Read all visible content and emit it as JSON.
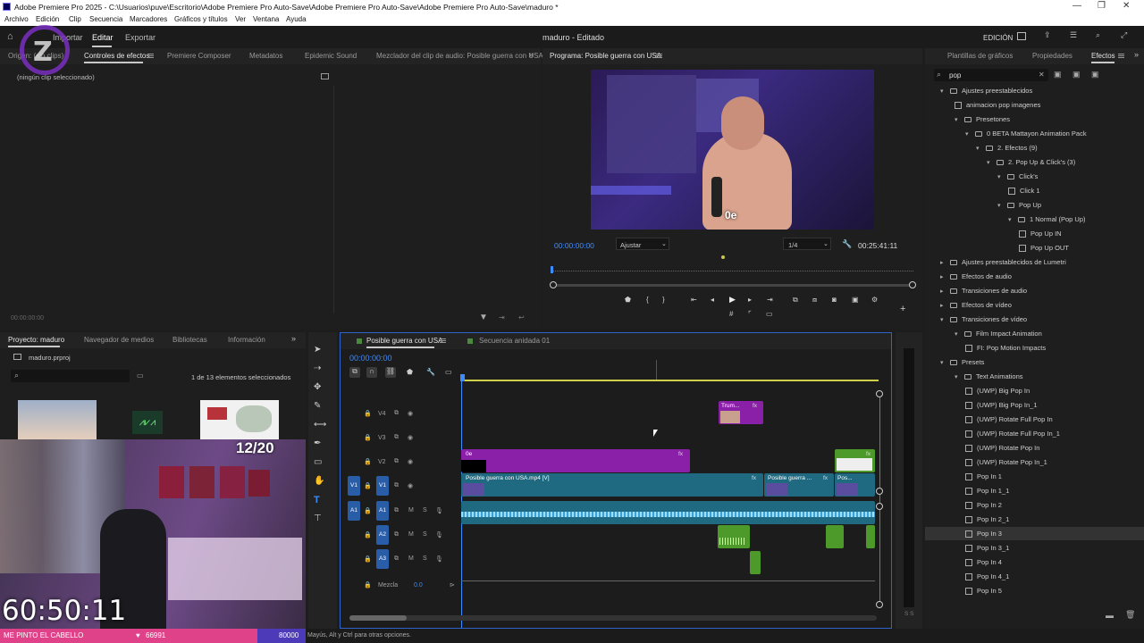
{
  "window": {
    "title": "Adobe Premiere Pro 2025 - C:\\Usuarios\\puve\\Escritorio\\Adobe Premiere Pro Auto-Save\\Adobe Premiere Pro Auto-Save\\Adobe Premiere Pro Auto-Save\\maduro *",
    "controls": [
      "—",
      "❐",
      "✕"
    ]
  },
  "menu": [
    "Archivo",
    "Edición",
    "Clip",
    "Secuencia",
    "Marcadores",
    "Gráficos y títulos",
    "Ver",
    "Ventana",
    "Ayuda"
  ],
  "topbar": {
    "tabs": [
      "Importar",
      "Editar",
      "Exportar"
    ],
    "project_title": "maduro - Editado",
    "workspace": "EDICIÓN"
  },
  "source_panel": {
    "tabs": [
      "Origen: (sin clips)",
      "Controles de efectos",
      "Premiere Composer",
      "Metadatos",
      "Epidemic Sound",
      "Mezclador del clip de audio: Posible guerra con USA"
    ],
    "no_clip": "(ningún clip seleccionado)",
    "timecode": "00:00:00:00"
  },
  "program": {
    "tab": "Programa: Posible guerra con USA",
    "timecode": "00:00:00:00",
    "fit": "Ajustar",
    "quality": "1/4",
    "duration": "00:25:41:11",
    "video_text": "0e"
  },
  "effects_panel": {
    "tabs": [
      "Plantillas de gráficos",
      "Propiedades",
      "Efectos"
    ],
    "search": "pop",
    "tree": [
      {
        "label": "Ajustes preestablecidos",
        "kind": "folder",
        "open": true,
        "level": 0
      },
      {
        "label": "animacion pop imagenes",
        "kind": "item",
        "level": 1
      },
      {
        "label": "Presetones",
        "kind": "folder",
        "open": true,
        "level": 1
      },
      {
        "label": "0 BETA Mattayon Animation Pack",
        "kind": "folder",
        "open": true,
        "level": 2
      },
      {
        "label": "2. Efectos (9)",
        "kind": "folder",
        "open": true,
        "level": 3
      },
      {
        "label": "2. Pop Up & Click's (3)",
        "kind": "folder",
        "open": true,
        "level": 4
      },
      {
        "label": "Click's",
        "kind": "folder",
        "open": true,
        "level": 5
      },
      {
        "label": "Click 1",
        "kind": "item",
        "level": 6
      },
      {
        "label": "Pop Up",
        "kind": "folder",
        "open": true,
        "level": 5
      },
      {
        "label": "1 Normal (Pop Up)",
        "kind": "folder",
        "open": true,
        "level": 6
      },
      {
        "label": "Pop Up IN",
        "kind": "item",
        "level": 7
      },
      {
        "label": "Pop Up OUT",
        "kind": "item",
        "level": 7
      },
      {
        "label": "Ajustes preestablecidos de Lumetri",
        "kind": "folder",
        "open": false,
        "level": 0
      },
      {
        "label": "Efectos de audio",
        "kind": "folder",
        "open": false,
        "level": 0
      },
      {
        "label": "Transiciones de audio",
        "kind": "folder",
        "open": false,
        "level": 0
      },
      {
        "label": "Efectos de vídeo",
        "kind": "folder",
        "open": false,
        "level": 0
      },
      {
        "label": "Transiciones de vídeo",
        "kind": "folder",
        "open": true,
        "level": 0
      },
      {
        "label": "Film Impact Animation",
        "kind": "folder",
        "open": true,
        "level": 1
      },
      {
        "label": "FI: Pop Motion Impacts",
        "kind": "item",
        "level": 2
      },
      {
        "label": "Presets",
        "kind": "folder",
        "open": true,
        "level": 0
      },
      {
        "label": "Text Animations",
        "kind": "folder",
        "open": true,
        "level": 1
      },
      {
        "label": "(UWP) Big Pop In",
        "kind": "item",
        "level": 2
      },
      {
        "label": "(UWP) Big Pop In_1",
        "kind": "item",
        "level": 2
      },
      {
        "label": "(UWP) Rotate Full Pop In",
        "kind": "item",
        "level": 2
      },
      {
        "label": "(UWP) Rotate Full Pop In_1",
        "kind": "item",
        "level": 2
      },
      {
        "label": "(UWP) Rotate Pop In",
        "kind": "item",
        "level": 2
      },
      {
        "label": "(UWP) Rotate Pop In_1",
        "kind": "item",
        "level": 2
      },
      {
        "label": "Pop In 1",
        "kind": "item",
        "level": 2
      },
      {
        "label": "Pop In 1_1",
        "kind": "item",
        "level": 2
      },
      {
        "label": "Pop In 2",
        "kind": "item",
        "level": 2
      },
      {
        "label": "Pop In 2_1",
        "kind": "item",
        "level": 2
      },
      {
        "label": "Pop In 3",
        "kind": "item",
        "level": 2,
        "selected": true
      },
      {
        "label": "Pop In 3_1",
        "kind": "item",
        "level": 2
      },
      {
        "label": "Pop In 4",
        "kind": "item",
        "level": 2
      },
      {
        "label": "Pop In 4_1",
        "kind": "item",
        "level": 2
      },
      {
        "label": "Pop In 5",
        "kind": "item",
        "level": 2
      }
    ]
  },
  "project_panel": {
    "tabs": [
      "Proyecto: maduro",
      "Navegador de medios",
      "Bibliotecas",
      "Información"
    ],
    "file": "maduro.prproj",
    "count": "1 de 13 elementos seleccionados"
  },
  "timeline": {
    "tabs": [
      "Posible guerra con USA",
      "Secuencia anidada 01"
    ],
    "timecode": "00:00:00:00",
    "video_tracks": [
      "V4",
      "V3",
      "V2",
      "V1"
    ],
    "audio_tracks": [
      "A1",
      "A2",
      "A3"
    ],
    "mix_label": "Mezcla",
    "mix_value": "0.0",
    "clips": {
      "v4": "Trum...",
      "v2_title": "0e",
      "v1_main": "Posible guerra con USA.mp4 [V]",
      "v1_second": "Posible guerra ...",
      "v1_third": "Pos..."
    }
  },
  "stream_overlay": {
    "counter": "12/20",
    "big_time": "60:50:11",
    "bar_text": "ME PINTO EL CABELLO",
    "bar_points": "66991",
    "bar_goal": "80000"
  },
  "status": "Mayús, Alt y Ctrl para otras opciones.",
  "colors": {
    "accent_blue": "#3d8cff",
    "clip_purple": "#8a1fa8",
    "clip_teal": "#1f6a80",
    "clip_green": "#4d9a2a",
    "overlay_pink": "#e0428a"
  }
}
